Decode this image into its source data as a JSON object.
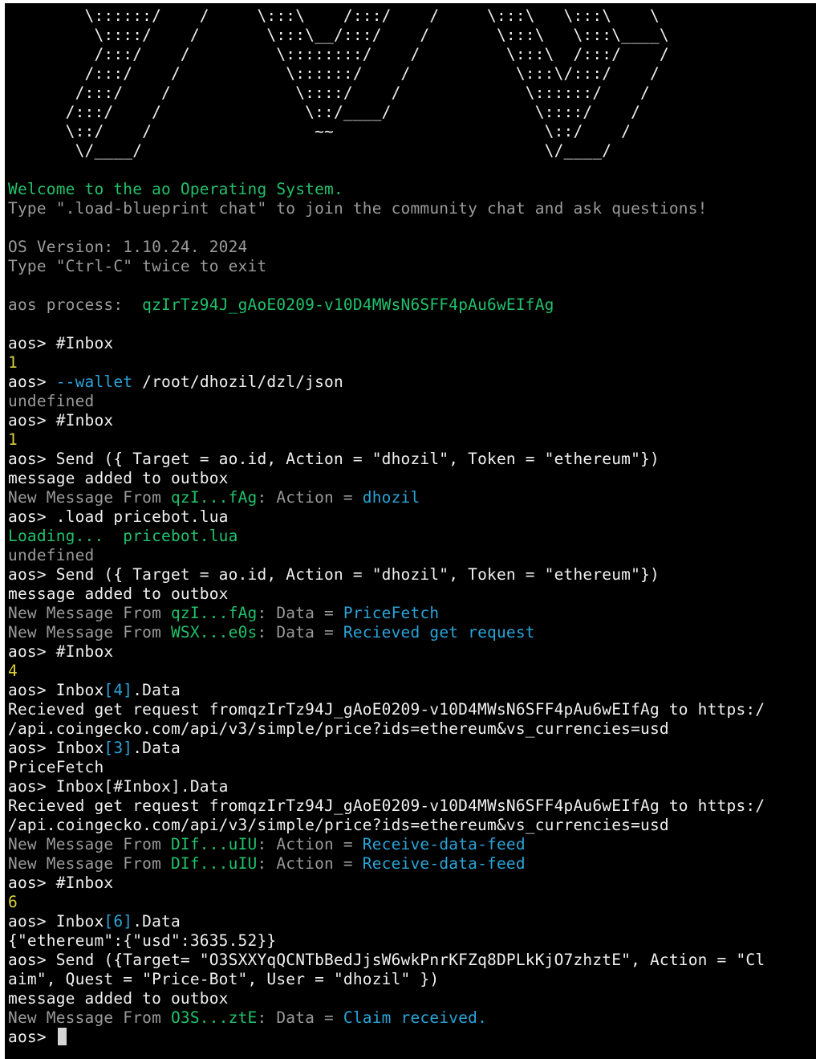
{
  "colors": {
    "background": "#000000",
    "text": "#f0f0f0",
    "green": "#21c16b",
    "gray": "#9a9a9a",
    "blue": "#2aa4d8",
    "yellow": "#d8cf3a"
  },
  "ascii_art": [
    "        \\::::::/    /     \\:::\\    /:::/    /     \\:::\\   \\:::\\    \\",
    "         \\::::/    /       \\:::\\__/:::/    /       \\:::\\   \\:::\\____\\",
    "         /:::/    /         \\::::::::/    /         \\:::\\  /:::/    /",
    "        /:::/    /           \\::::::/    /           \\:::\\/:::/    /",
    "       /:::/    /             \\::::/    /             \\::::::/    /",
    "      /:::/    /               \\::/____/               \\::::/    /",
    "      \\::/    /                 ~~                      \\::/    /",
    "       \\/____/                                          \\/____/"
  ],
  "welcome": "Welcome to the ao Operating System.",
  "blueprint_hint": "Type \".load-blueprint chat\" to join the community chat and ask questions!",
  "os_version": "OS Version: 1.10.24. 2024",
  "exit_hint": "Type \"Ctrl-C\" twice to exit",
  "process_label": "aos process:  ",
  "process_id": "qzIrTz94J_gAoE0209-v10D4MWsN6SFF4pAu6wEIfAg",
  "prompt": "aos> ",
  "session": {
    "cmd1": "#Inbox",
    "out1": "1",
    "cmd2_flag": "--wallet",
    "cmd2_path": " /root/dhozil/dzl/json",
    "out2": "undefined",
    "cmd3": "#Inbox",
    "out3": "1",
    "cmd4": "Send ({ Target = ao.id, Action = \"dhozil\", Token = \"ethereum\"})",
    "out4": "message added to outbox",
    "msg1": {
      "prefix": "New Message From ",
      "from": "qzI...fAg",
      "mid": ": Action = ",
      "value": "dhozil"
    },
    "cmd5": ".load pricebot.lua",
    "loading_label": "Loading...  ",
    "loading_file": "pricebot.lua",
    "out5": "undefined",
    "cmd6": "Send ({ Target = ao.id, Action = \"dhozil\", Token = \"ethereum\"})",
    "out6": "message added to outbox",
    "msg2": {
      "prefix": "New Message From ",
      "from": "qzI...fAg",
      "mid": ": Data = ",
      "value": "PriceFetch"
    },
    "msg3": {
      "prefix": "New Message From ",
      "from": "WSX...e0s",
      "mid": ": Data = ",
      "value": "Recieved get request"
    },
    "cmd7": "#Inbox",
    "out7": "4",
    "cmd8_a": "Inbox",
    "cmd8_b": "[4]",
    "cmd8_c": ".Data",
    "out8_1": "Recieved get request fromqzIrTz94J_gAoE0209-v10D4MWsN6SFF4pAu6wEIfAg to https:/",
    "out8_2": "/api.coingecko.com/api/v3/simple/price?ids=ethereum&vs_currencies=usd",
    "cmd9_a": "Inbox",
    "cmd9_b": "[3]",
    "cmd9_c": ".Data",
    "out9": "PriceFetch",
    "cmd10": "Inbox[#Inbox].Data",
    "out10_1": "Recieved get request fromqzIrTz94J_gAoE0209-v10D4MWsN6SFF4pAu6wEIfAg to https:/",
    "out10_2": "/api.coingecko.com/api/v3/simple/price?ids=ethereum&vs_currencies=usd",
    "msg4": {
      "prefix": "New Message From ",
      "from": "DIf...uIU",
      "mid": ": Action = ",
      "value": "Receive-data-feed"
    },
    "msg5": {
      "prefix": "New Message From ",
      "from": "DIf...uIU",
      "mid": ": Action = ",
      "value": "Receive-data-feed"
    },
    "cmd11": "#Inbox",
    "out11": "6",
    "cmd12_a": "Inbox",
    "cmd12_b": "[6]",
    "cmd12_c": ".Data",
    "out12": "{\"ethereum\":{\"usd\":3635.52}}",
    "cmd13_1": "Send ({Target= \"O3SXXYqQCNTbBedJjsW6wkPnrKFZq8DPLkKjO7zhztE\", Action = \"Cl",
    "cmd13_2": "aim\", Quest = \"Price-Bot\", User = \"dhozil\" })",
    "out13": "message added to outbox",
    "msg6": {
      "prefix": "New Message From ",
      "from": "O3S...ztE",
      "mid": ": Data = ",
      "value": "Claim received."
    }
  }
}
